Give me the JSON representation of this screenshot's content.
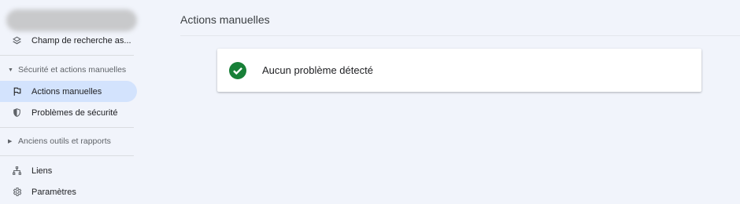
{
  "sidebar": {
    "search_field_item": {
      "label": "Champ de recherche as...",
      "icon": "layers-icon"
    },
    "security_section": {
      "label": "Sécurité et actions manuelles",
      "expanded": true
    },
    "items": [
      {
        "label": "Actions manuelles",
        "icon": "flag-icon",
        "active": true
      },
      {
        "label": "Problèmes de sécurité",
        "icon": "shield-icon",
        "active": false
      }
    ],
    "legacy_section": {
      "label": "Anciens outils et rapports",
      "expanded": false
    },
    "bottom_items": [
      {
        "label": "Liens",
        "icon": "sitemap-icon"
      },
      {
        "label": "Paramètres",
        "icon": "gear-icon"
      }
    ]
  },
  "main": {
    "title": "Actions manuelles",
    "status_card": {
      "message": "Aucun problème détecté",
      "status": "ok",
      "status_color": "#188038"
    }
  },
  "colors": {
    "background": "#f1f4fb",
    "active_nav": "#d3e3fd",
    "success": "#188038"
  }
}
